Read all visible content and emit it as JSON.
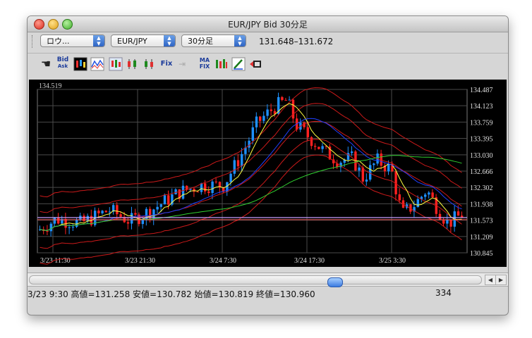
{
  "window": {
    "title": "EUR/JPY Bid 30分足"
  },
  "toolbar": {
    "chart_style": "ロウ...",
    "pair": "EUR/JPY",
    "timeframe": "30分足",
    "quote_range": "131.648–131.672",
    "icons": [
      "hand-icon",
      "bid-ask-icon",
      "candle-chart-icon",
      "line-chart-icon",
      "candle-a-icon",
      "candle-b-icon",
      "candle-c-icon",
      "fix-icon",
      "arrow-icon",
      "ma-fix-icon",
      "bar-icon",
      "pencil-icon",
      "export-icon"
    ],
    "bid_label": "Bid",
    "ask_label": "Ask",
    "fix_label": "Fix",
    "ma_label": "MA",
    "ma_fix_label": "FIX"
  },
  "chart_data": {
    "type": "candlestick",
    "top_left_label": "134.519",
    "y_ticks": [
      "134.487",
      "134.123",
      "133.759",
      "133.395",
      "133.030",
      "132.666",
      "132.302",
      "131.938",
      "131.573",
      "131.209",
      "130.845"
    ],
    "y_range": [
      130.845,
      134.487
    ],
    "x_ticks": [
      "3/23 11:30",
      "3/23 21:30",
      "3/24 7:30",
      "3/24 17:30",
      "3/25 3:30"
    ],
    "reference_line": 131.63,
    "colors": {
      "up": "#1e90ff",
      "down": "#ff2020",
      "bollinger": "#cc1a1a",
      "ma_short": "#ffff40",
      "ma_mid": "#2040ff",
      "ma_long": "#30d030",
      "grid": "#4a4a4a",
      "reference": "#c8a0ff"
    }
  },
  "scrollbar": {
    "position": 0.68
  },
  "status": {
    "text": "3/23 9:30 高値=131.258 安値=130.782 始値=130.819 終値=130.960",
    "count": "334"
  }
}
